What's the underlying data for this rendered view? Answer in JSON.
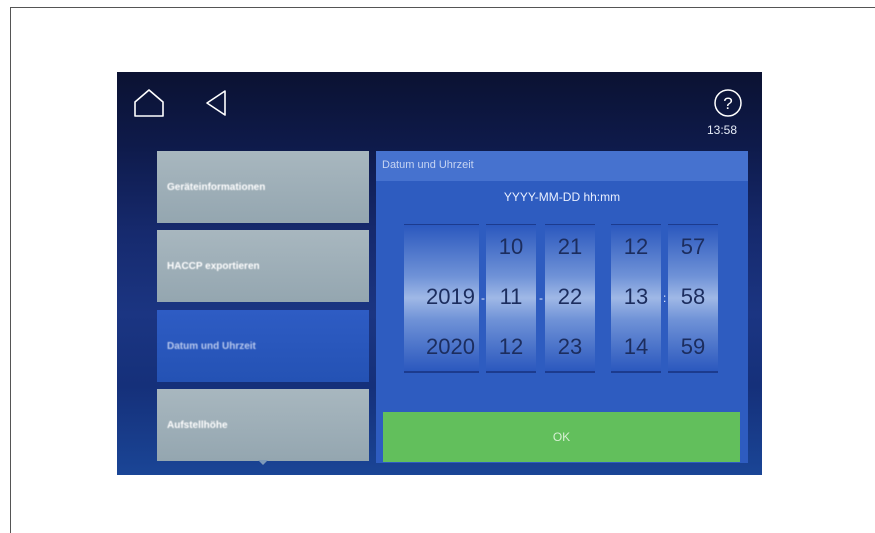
{
  "header": {
    "time": "13:58"
  },
  "menu": {
    "items": [
      {
        "label": "Geräteinformationen"
      },
      {
        "label": "HACCP exportieren"
      },
      {
        "label": "Datum und Uhrzeit"
      },
      {
        "label": "Aufstellhöhe"
      }
    ],
    "active_index": 2
  },
  "panel": {
    "title": "Datum und Uhrzeit",
    "format": "YYYY-MM-DD hh:mm",
    "year": {
      "prev": "",
      "current": "2019",
      "next": "2020"
    },
    "month": {
      "prev": "10",
      "current": "11",
      "next": "12"
    },
    "day": {
      "prev": "21",
      "current": "22",
      "next": "23"
    },
    "hour": {
      "prev": "12",
      "current": "13",
      "next": "14"
    },
    "minute": {
      "prev": "57",
      "current": "58",
      "next": "59"
    },
    "date_separator": "-",
    "time_separator": ":",
    "ok_label": "OK"
  },
  "colors": {
    "accent_green": "#62bf5c",
    "panel_blue": "#2e5cc0",
    "menu_grey": "#a8b7bf"
  }
}
